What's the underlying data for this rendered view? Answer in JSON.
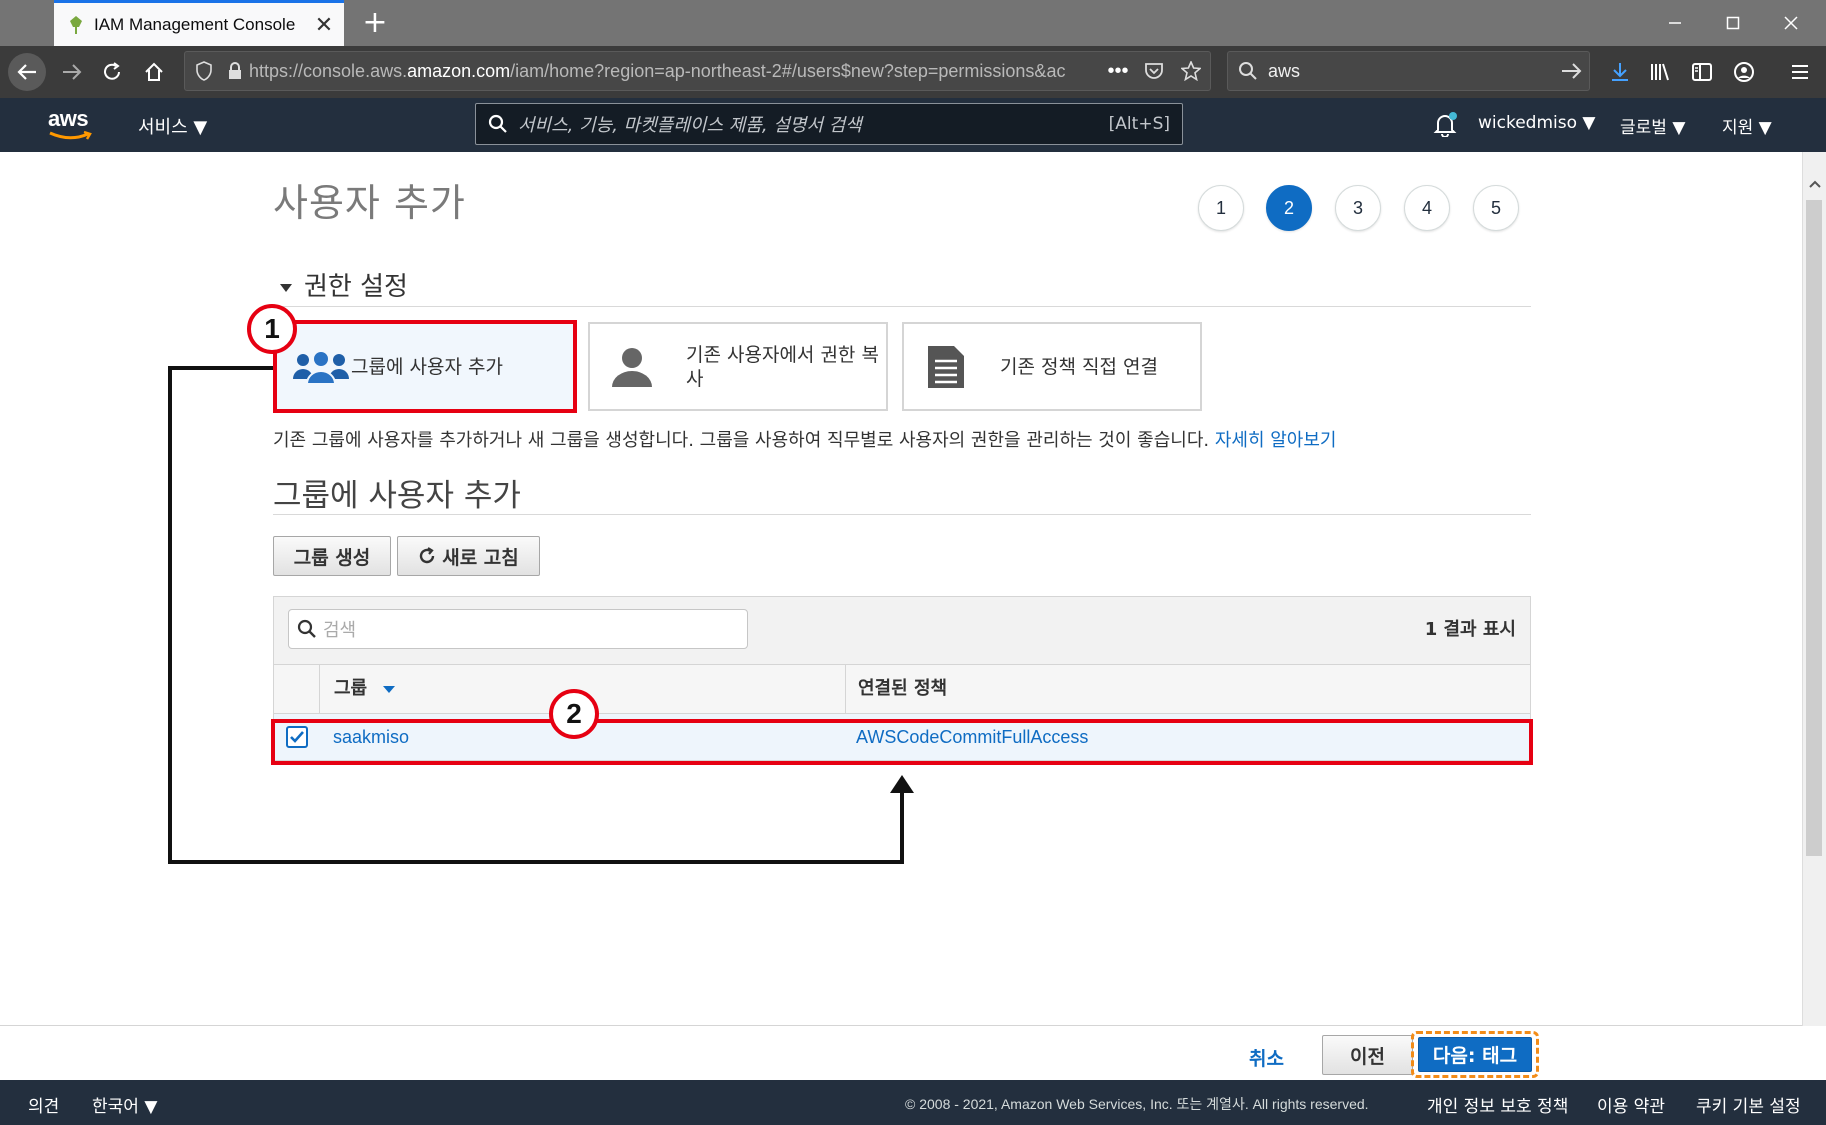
{
  "browser": {
    "tab_title": "IAM Management Console",
    "url_prefix": "https://console.aws.",
    "url_domain": "amazon.com",
    "url_rest": "/iam/home?region=ap-northeast-2#/users$new?step=permissions&ac",
    "search_value": "aws"
  },
  "aws_header": {
    "logo": "aws",
    "services_label": "서비스 ▼",
    "search_placeholder": "서비스, 기능, 마켓플레이스 제품, 설명서 검색",
    "search_shortcut": "[Alt+S]",
    "user_label": "wickedmiso ▼",
    "region_label": "글로벌 ▼",
    "support_label": "지원 ▼"
  },
  "page": {
    "title": "사용자 추가",
    "steps": [
      "1",
      "2",
      "3",
      "4",
      "5"
    ],
    "active_step": "2",
    "section_heading": "권한 설정",
    "options": [
      {
        "label": "그룹에 사용자 추가",
        "icon": "users-group-icon",
        "selected": true
      },
      {
        "label": "기존 사용자에서 권한 복사",
        "icon": "user-icon",
        "selected": false
      },
      {
        "label": "기존 정책 직접 연결",
        "icon": "document-icon",
        "selected": false
      }
    ],
    "description": "기존 그룹에 사용자를 추가하거나 새 그룹을 생성합니다. 그룹을 사용하여 직무별로 사용자의 권한을 관리하는 것이 좋습니다.",
    "learn_more": "자세히 알아보기",
    "subsection_title": "그룹에 사용자 추가",
    "create_group_label": "그룹 생성",
    "refresh_label": "새로 고침"
  },
  "table": {
    "search_placeholder": "검색",
    "result_count": "1 결과 표시",
    "columns": [
      "그룹",
      "연결된 정책"
    ],
    "rows": [
      {
        "group": "saakmiso",
        "policy": "AWSCodeCommitFullAccess",
        "checked": true
      }
    ]
  },
  "annotations": {
    "badge1": "1",
    "badge2": "2",
    "highlight_color": "#e60012"
  },
  "actions": {
    "cancel": "취소",
    "previous": "이전",
    "next": "다음: 태그"
  },
  "footer": {
    "feedback": "의견",
    "language": "한국어 ▼",
    "copyright": "© 2008 - 2021, Amazon Web Services, Inc. 또는 계열사. All rights reserved.",
    "privacy": "개인 정보 보호 정책",
    "terms": "이용 약관",
    "cookies": "쿠키 기본 설정"
  },
  "colors": {
    "aws_navy": "#232f3e",
    "link_blue": "#0f6cc3",
    "focus_orange": "#f28c18"
  }
}
